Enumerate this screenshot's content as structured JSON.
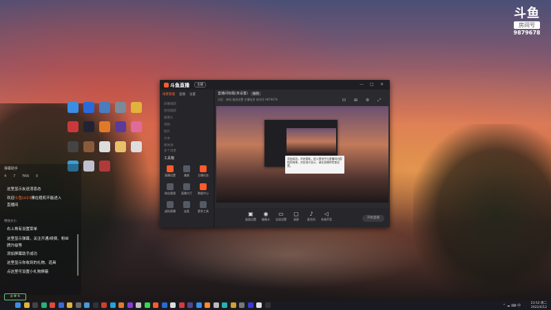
{
  "watermark": {
    "logo": "斗鱼",
    "room_label": "房间号",
    "room_number": "9879678"
  },
  "desktop_icons": [
    {
      "name": "browser-icon",
      "color": "#3a8ee6"
    },
    {
      "name": "star-icon",
      "color": "#2a6ad8"
    },
    {
      "name": "recycle-icon",
      "color": "#4a7cc0"
    },
    {
      "name": "gear-icon",
      "color": "#7a8a9a"
    },
    {
      "name": "chrome-icon",
      "color": "#e2b33a"
    },
    {
      "name": "game-icon",
      "color": "#c83a3a"
    },
    {
      "name": "game-icon",
      "color": "#222233"
    },
    {
      "name": "app-icon",
      "color": "#e07a2a"
    },
    {
      "name": "video-icon",
      "color": "#5a3a9a"
    },
    {
      "name": "app-icon",
      "color": "#e06a9a"
    },
    {
      "name": "person-icon",
      "color": "#444"
    },
    {
      "name": "game-icon",
      "color": "#8a5a3a"
    },
    {
      "name": "doc-icon",
      "color": "#dddddd"
    },
    {
      "name": "folder-icon",
      "color": "#e8c06a"
    },
    {
      "name": "doc-icon",
      "color": "#dddddd"
    },
    {
      "name": "app-icon",
      "color": "#3aa0d8"
    },
    {
      "name": "app-icon",
      "color": "#c0c0d0"
    },
    {
      "name": "game-icon",
      "color": "#b03a3a"
    }
  ],
  "chat": {
    "header": "弹幕助手",
    "stats": [
      "4",
      "7",
      "FAN",
      "0"
    ],
    "lines": [
      {
        "prefix": "",
        "text": "这里显示友送消息态"
      },
      {
        "prefix": "欢迎",
        "highlight": "斗鱼LV23",
        "text": "雅在粗机不能进入"
      },
      {
        "prefix": "",
        "text": "直播间"
      },
      {
        "prefix": "",
        "text": "右上角有设置菜单"
      },
      {
        "prefix": "",
        "text": "这里显示弹幕，关注开通/续费、粉丝"
      },
      {
        "prefix": "",
        "text": "牌升级等"
      },
      {
        "prefix": "",
        "text": "添加屏幕助手成功"
      },
      {
        "prefix": "",
        "text": "这里显示你收到的礼物、道具"
      },
      {
        "prefix": "",
        "text": "点这里可设置小礼物屏蔽"
      }
    ],
    "small_line": "特效大小",
    "bottom_label": "◎ ⚙ ↻"
  },
  "app": {
    "title": "斗鱼直播",
    "badge": "主播",
    "controls": [
      "—",
      "□",
      "✕"
    ],
    "side_tabs": [
      {
        "label": "场景管理",
        "active": true
      },
      {
        "label": "直播",
        "active": false
      },
      {
        "label": "设置",
        "active": false
      }
    ],
    "scenes": [
      "屏幕捕获",
      "游戏捕获",
      "摄像头",
      "视频",
      "图片",
      "文本",
      "媒体源",
      "多个场景"
    ],
    "tools_title": "工具箱",
    "tools": [
      {
        "label": "直播设置",
        "color": "#ff5a2a"
      },
      {
        "label": "美颜",
        "color": "#555a66"
      },
      {
        "label": "主播任务",
        "color": "#ff5a2a"
      },
      {
        "label": "粉丝管理",
        "color": "#555a66"
      },
      {
        "label": "直播大厅",
        "color": "#555a66"
      },
      {
        "label": "数据中心",
        "color": "#ff5a2a"
      },
      {
        "label": "虚拟直播",
        "color": "#555a66"
      },
      {
        "label": "连麦",
        "color": "#555a66"
      },
      {
        "label": "更多工具",
        "color": "#555a66"
      }
    ],
    "stage": {
      "title": "直播间标题(未设置)",
      "tag": "编辑",
      "subline": "分区：单机   推流设置   主播信息   房间号   9879678",
      "icons": "⊡ ⊞ ⚙ ⤢"
    },
    "tooltip": "添加成功，开启帮助，进入预览中与直播间内容相同效果，对应观众显示、请在直播时检查设置。",
    "bottom_buttons": [
      {
        "icon": "▣",
        "label": "画面设置"
      },
      {
        "icon": "◉",
        "label": "摄像头"
      },
      {
        "icon": "▭",
        "label": "全局设置"
      },
      {
        "icon": "▢",
        "label": "录屏"
      },
      {
        "icon": "♪",
        "label": "麦克风"
      },
      {
        "icon": "◁",
        "label": "系统声音"
      }
    ],
    "live_button": "开始直播"
  },
  "taskbar": {
    "time": "23:52 周二",
    "date": "2022/4/12",
    "tray": "^ ☁ ⌨ 中",
    "icons": [
      "#3a8ee6",
      "#e2b33a",
      "#444",
      "#2ab07a",
      "#e04a3a",
      "#3a6ad8",
      "#e2b33a",
      "#6a6a6a",
      "#4a9ad8",
      "#333",
      "#d0402a",
      "#2aa0d8",
      "#e07a2a",
      "#8a3ad8",
      "#c0c0c0",
      "#3ad84a",
      "#ff5a2a",
      "#2a6ad8",
      "#dddddd",
      "#d83a3a",
      "#4a4a8a",
      "#3a8ee6",
      "#ff8a2a",
      "#bbbbbb",
      "#2ab0b0",
      "#d0a030",
      "#777777",
      "#3a3ad8",
      "#e0e0e0",
      "#333333"
    ]
  }
}
